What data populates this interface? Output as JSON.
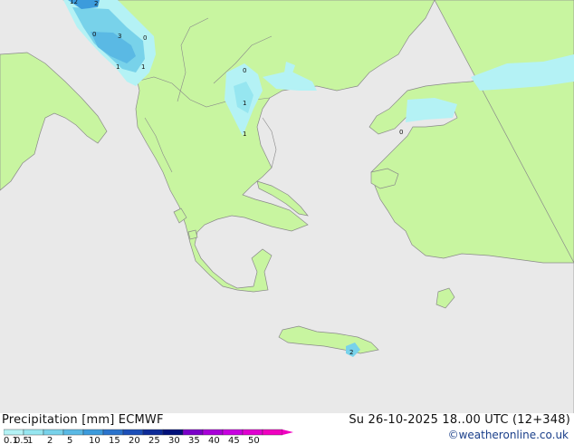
{
  "footer": {
    "title": "Precipitation [mm]  ECMWF",
    "datetime": "Su 26-10-2025 18..00 UTC (12+348)",
    "credit": "©weatheronline.co.uk"
  },
  "legend": {
    "ticks": [
      "0.1",
      "0.5",
      "1",
      "2",
      "5",
      "10",
      "15",
      "20",
      "25",
      "30",
      "35",
      "40",
      "45",
      "50"
    ],
    "colors": [
      "#b4f2f5",
      "#96e6f0",
      "#78d2ea",
      "#5ab9e4",
      "#3c9bdc",
      "#2a73cc",
      "#1c4fb8",
      "#0c2a98",
      "#00107a",
      "#7a00c8",
      "#a800d8",
      "#c800e0",
      "#e000d0",
      "#f000c0"
    ]
  },
  "map_labels": [
    {
      "text": "12"
    },
    {
      "text": "2"
    },
    {
      "text": "0"
    },
    {
      "text": "3"
    },
    {
      "text": "0"
    },
    {
      "text": "1"
    },
    {
      "text": "1"
    },
    {
      "text": "0"
    },
    {
      "text": "1"
    },
    {
      "text": "1"
    },
    {
      "text": "0"
    },
    {
      "text": "2"
    }
  ],
  "colors": {
    "sea": "#e9e9e9",
    "land": "#c8f5a0",
    "border": "#8a8a8a"
  }
}
